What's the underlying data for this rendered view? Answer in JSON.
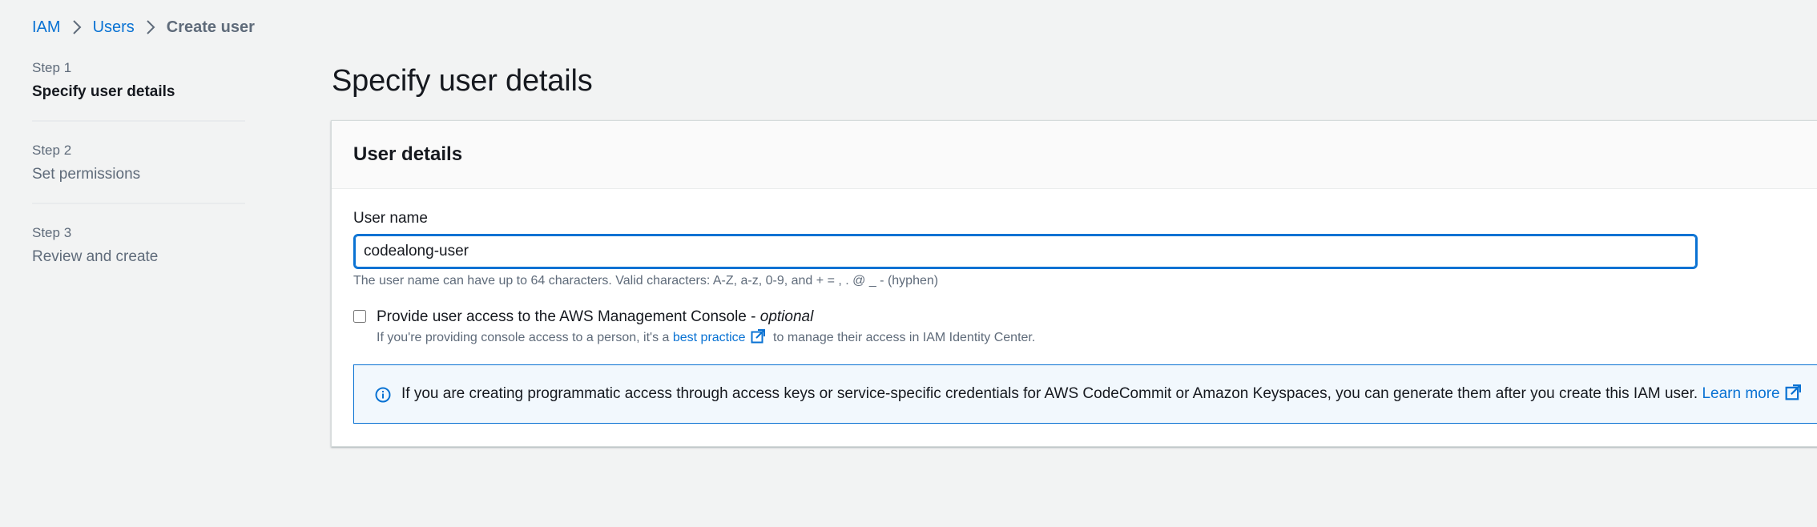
{
  "breadcrumb": {
    "items": [
      "IAM",
      "Users"
    ],
    "current": "Create user"
  },
  "wizard": {
    "steps": [
      {
        "number": "Step 1",
        "title": "Specify user details",
        "active": true
      },
      {
        "number": "Step 2",
        "title": "Set permissions",
        "active": false
      },
      {
        "number": "Step 3",
        "title": "Review and create",
        "active": false
      }
    ]
  },
  "page": {
    "title": "Specify user details"
  },
  "panel": {
    "header": "User details",
    "user_name_label": "User name",
    "user_name_value": "codealong-user",
    "user_name_constraint": "The user name can have up to 64 characters. Valid characters: A-Z, a-z, 0-9, and + = , . @ _ - (hyphen)",
    "console_access": {
      "label": "Provide user access to the AWS Management Console - ",
      "optional": "optional",
      "checked": false,
      "desc_prefix": "If you're providing console access to a person, it's a ",
      "desc_link": "best practice",
      "desc_suffix": " to manage their access in IAM Identity Center."
    },
    "info_alert": {
      "text": "If you are creating programmatic access through access keys or service-specific credentials for AWS CodeCommit or Amazon Keyspaces, you can generate them after you create this IAM user. ",
      "link": "Learn more"
    }
  },
  "colors": {
    "link": "#0972d3",
    "page_bg": "#f2f3f3",
    "text": "#16191f",
    "muted": "#5f6b7a",
    "info_bg": "#f2f8fd"
  }
}
